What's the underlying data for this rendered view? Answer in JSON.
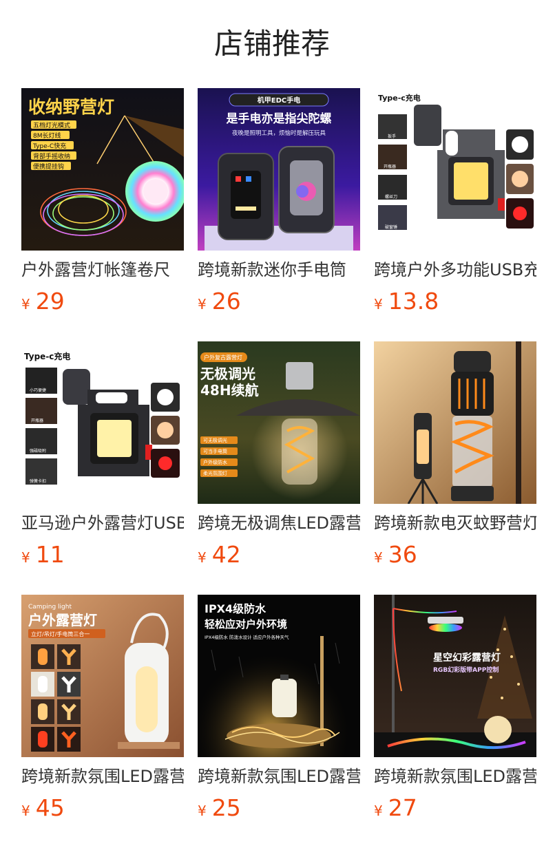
{
  "page": {
    "title": "店铺推荐"
  },
  "products": [
    {
      "name": "户外露营灯帐篷卷尺",
      "currency": "¥",
      "price": "29",
      "image": {
        "headline": "收纳野营灯",
        "bullets": [
          "五档灯光模式",
          "8M长灯线",
          "Type-C快充",
          "背部手摇收纳",
          "便携提挂钩"
        ]
      }
    },
    {
      "name": "跨境新款迷你手电筒",
      "currency": "¥",
      "price": "26",
      "image": {
        "badge": "机甲EDC手电",
        "headline": "是手电亦是指尖陀螺",
        "sub": "夜晚是照明工具，烦恼时是解压玩具"
      }
    },
    {
      "name": "跨境户外多功能USB充",
      "currency": "¥",
      "price": "13.8",
      "image": {
        "headline": "Type-c充电",
        "bullets": [
          "扳手",
          "开瓶器",
          "螺丝刀",
          "破窗锤"
        ]
      }
    },
    {
      "name": "亚马逊户外露营灯USB",
      "currency": "¥",
      "price": "11",
      "image": {
        "headline": "Type-c充电",
        "bullets": [
          "小巧便捷",
          "开瓶器",
          "强磁吸附",
          "弹簧卡扣"
        ]
      }
    },
    {
      "name": "跨境无极调焦LED露营",
      "currency": "¥",
      "price": "42",
      "image": {
        "badge": "户外复古露营灯",
        "headline": "无极调光",
        "headline2": "48H续航",
        "bullets": [
          "可无极调光",
          "可当手电筒",
          "户外级防水",
          "柔光氛围灯"
        ]
      }
    },
    {
      "name": "跨境新款电灭蚊野营灯",
      "currency": "¥",
      "price": "36",
      "image": {}
    },
    {
      "name": "跨境新款氛围LED露营",
      "currency": "¥",
      "price": "45",
      "image": {
        "badge": "Camping light",
        "headline": "户外露营灯",
        "sub": "立灯/吊灯/手电筒三合一"
      }
    },
    {
      "name": "跨境新款氛围LED露营",
      "currency": "¥",
      "price": "25",
      "image": {
        "headline": "IPX4级防水",
        "headline2": "轻松应对户外环境",
        "sub": "IPX4级防水 防泼水设计 适应户外各种天气"
      }
    },
    {
      "name": "跨境新款氛围LED露营",
      "currency": "¥",
      "price": "27",
      "image": {
        "headline": "星空幻彩露营灯",
        "sub": "RGB幻彩版带APP控制"
      }
    }
  ]
}
